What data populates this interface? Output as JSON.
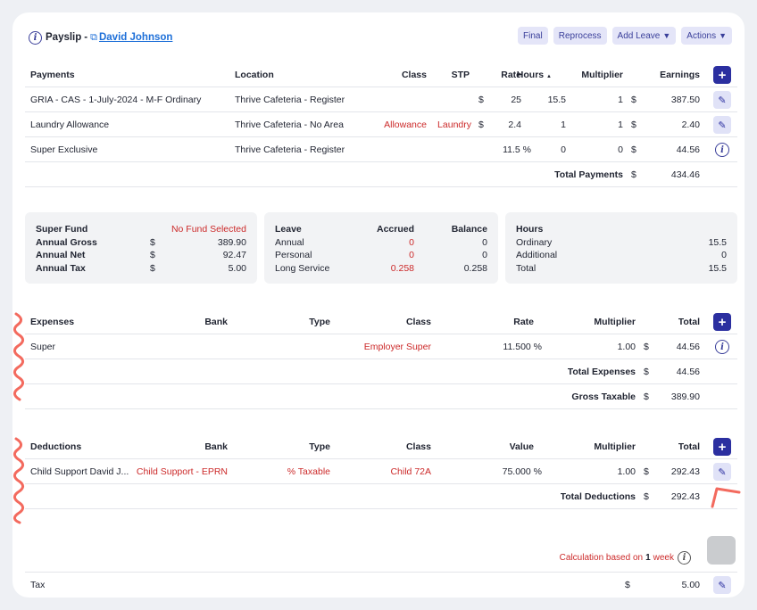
{
  "header": {
    "title": "Payslip",
    "separator": "-",
    "employee_name": "David Johnson"
  },
  "actions": {
    "final": "Final",
    "reprocess": "Reprocess",
    "add_leave": "Add Leave",
    "actions": "Actions"
  },
  "payments": {
    "headers": {
      "payments": "Payments",
      "location": "Location",
      "class": "Class",
      "stp": "STP",
      "rate": "Rate",
      "hours": "Hours",
      "sort_indicator": "▲",
      "multiplier": "Multiplier",
      "earnings": "Earnings"
    },
    "rows": [
      {
        "name": "GRIA - CAS - 1-July-2024 - M-F Ordinary",
        "location": "Thrive Cafeteria - Register",
        "class": "",
        "stp": "",
        "currency": "$",
        "rate": "25",
        "hours": "15.5",
        "multiplier": "1",
        "earnings_currency": "$",
        "earnings": "387.50"
      },
      {
        "name": "Laundry Allowance",
        "location": "Thrive Cafeteria - No Area",
        "class": "Allowance",
        "stp": "Laundry",
        "currency": "$",
        "rate": "2.4",
        "hours": "1",
        "multiplier": "1",
        "earnings_currency": "$",
        "earnings": "2.40"
      },
      {
        "name": "Super Exclusive",
        "location": "Thrive Cafeteria - Register",
        "class": "",
        "stp": "",
        "currency": "",
        "rate": "11.5 %",
        "hours": "0",
        "multiplier": "0",
        "earnings_currency": "$",
        "earnings": "44.56"
      }
    ],
    "total_label": "Total Payments",
    "total_currency": "$",
    "total": "434.46"
  },
  "summary": {
    "super": {
      "fund_label": "Super Fund",
      "fund_value": "No Fund Selected",
      "rows": [
        {
          "label": "Annual Gross",
          "currency": "$",
          "value": "389.90"
        },
        {
          "label": "Annual Net",
          "currency": "$",
          "value": "92.47"
        },
        {
          "label": "Annual Tax",
          "currency": "$",
          "value": "5.00"
        }
      ]
    },
    "leave": {
      "headers": {
        "leave": "Leave",
        "accrued": "Accrued",
        "balance": "Balance"
      },
      "rows": [
        {
          "label": "Annual",
          "accrued": "0",
          "balance": "0"
        },
        {
          "label": "Personal",
          "accrued": "0",
          "balance": "0"
        },
        {
          "label": "Long Service",
          "accrued": "0.258",
          "balance": "0.258"
        }
      ]
    },
    "hours": {
      "title": "Hours",
      "rows": [
        {
          "label": "Ordinary",
          "value": "15.5"
        },
        {
          "label": "Additional",
          "value": "0"
        },
        {
          "label": "Total",
          "value": "15.5"
        }
      ]
    }
  },
  "expenses": {
    "headers": {
      "expenses": "Expenses",
      "bank": "Bank",
      "type": "Type",
      "class": "Class",
      "rate": "Rate",
      "multiplier": "Multiplier",
      "total": "Total"
    },
    "rows": [
      {
        "name": "Super",
        "bank": "",
        "type": "",
        "class": "Employer Super",
        "rate": "11.500 %",
        "multiplier": "1.00",
        "currency": "$",
        "total": "44.56"
      }
    ],
    "total_label": "Total Expenses",
    "total_currency": "$",
    "total": "44.56",
    "gross_label": "Gross Taxable",
    "gross_currency": "$",
    "gross": "389.90"
  },
  "deductions": {
    "headers": {
      "deductions": "Deductions",
      "bank": "Bank",
      "type": "Type",
      "class": "Class",
      "value": "Value",
      "multiplier": "Multiplier",
      "total": "Total"
    },
    "rows": [
      {
        "name": "Child Support David J...",
        "bank": "Child Support - EPRN",
        "type": "% Taxable",
        "class": "Child 72A",
        "value": "75.000 %",
        "multiplier": "1.00",
        "currency": "$",
        "total": "292.43"
      }
    ],
    "total_label": "Total Deductions",
    "total_currency": "$",
    "total": "292.43"
  },
  "calc": {
    "prefix": "Calculation based on",
    "count": "1",
    "unit": "week"
  },
  "tax": {
    "label": "Tax",
    "currency": "$",
    "value": "5.00"
  },
  "colors": {
    "accent": "#2b2fa0",
    "link": "#1d6fd8",
    "red": "#cc2a2a",
    "annotation": "#f36a5e"
  }
}
